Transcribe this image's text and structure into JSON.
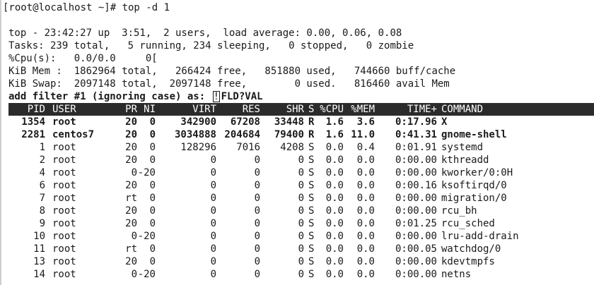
{
  "prompt": "[root@localhost ~]# top -d 1",
  "summary": {
    "top_line": "top - 23:42:27 up  3:51,  2 users,  load average: 0.00, 0.06, 0.08",
    "tasks_line": "Tasks: 239 total,   5 running, 234 sleeping,   0 stopped,   0 zombie",
    "cpu_line": "%Cpu(s):   0.0/0.0     0[",
    "mem_line": "KiB Mem :  1862964 total,   266424 free,   851880 used,   744660 buff/cache",
    "swap_line": "KiB Swap:  2097148 total,  2097148 free,        0 used.   816460 avail Mem"
  },
  "filter_prompt": {
    "label": "add filter #1 (ignoring case) as: ",
    "cursor": "!",
    "input": "FLD?VAL"
  },
  "columns": [
    "PID",
    "USER",
    "PR",
    "NI",
    "VIRT",
    "RES",
    "SHR",
    "S",
    "%CPU",
    "%MEM",
    "TIME+",
    "COMMAND"
  ],
  "processes": [
    {
      "pid": "1354",
      "user": "root",
      "pr": "20",
      "ni": "0",
      "virt": "342900",
      "res": "67208",
      "shr": "33448",
      "s": "R",
      "cpu": "1.6",
      "mem": "3.6",
      "time": "0:17.96",
      "cmd": "X",
      "bold": true
    },
    {
      "pid": "2281",
      "user": "centos7",
      "pr": "20",
      "ni": "0",
      "virt": "3034888",
      "res": "204684",
      "shr": "79400",
      "s": "R",
      "cpu": "1.6",
      "mem": "11.0",
      "time": "0:41.31",
      "cmd": "gnome-shell",
      "bold": true
    },
    {
      "pid": "1",
      "user": "root",
      "pr": "20",
      "ni": "0",
      "virt": "128296",
      "res": "7016",
      "shr": "4208",
      "s": "S",
      "cpu": "0.0",
      "mem": "0.4",
      "time": "0:01.91",
      "cmd": "systemd",
      "bold": false
    },
    {
      "pid": "2",
      "user": "root",
      "pr": "20",
      "ni": "0",
      "virt": "0",
      "res": "0",
      "shr": "0",
      "s": "S",
      "cpu": "0.0",
      "mem": "0.0",
      "time": "0:00.00",
      "cmd": "kthreadd",
      "bold": false
    },
    {
      "pid": "4",
      "user": "root",
      "pr": "0",
      "ni": "-20",
      "virt": "0",
      "res": "0",
      "shr": "0",
      "s": "S",
      "cpu": "0.0",
      "mem": "0.0",
      "time": "0:00.00",
      "cmd": "kworker/0:0H",
      "bold": false
    },
    {
      "pid": "6",
      "user": "root",
      "pr": "20",
      "ni": "0",
      "virt": "0",
      "res": "0",
      "shr": "0",
      "s": "S",
      "cpu": "0.0",
      "mem": "0.0",
      "time": "0:00.16",
      "cmd": "ksoftirqd/0",
      "bold": false
    },
    {
      "pid": "7",
      "user": "root",
      "pr": "rt",
      "ni": "0",
      "virt": "0",
      "res": "0",
      "shr": "0",
      "s": "S",
      "cpu": "0.0",
      "mem": "0.0",
      "time": "0:00.00",
      "cmd": "migration/0",
      "bold": false
    },
    {
      "pid": "8",
      "user": "root",
      "pr": "20",
      "ni": "0",
      "virt": "0",
      "res": "0",
      "shr": "0",
      "s": "S",
      "cpu": "0.0",
      "mem": "0.0",
      "time": "0:00.00",
      "cmd": "rcu_bh",
      "bold": false
    },
    {
      "pid": "9",
      "user": "root",
      "pr": "20",
      "ni": "0",
      "virt": "0",
      "res": "0",
      "shr": "0",
      "s": "S",
      "cpu": "0.0",
      "mem": "0.0",
      "time": "0:01.25",
      "cmd": "rcu_sched",
      "bold": false
    },
    {
      "pid": "10",
      "user": "root",
      "pr": "0",
      "ni": "-20",
      "virt": "0",
      "res": "0",
      "shr": "0",
      "s": "S",
      "cpu": "0.0",
      "mem": "0.0",
      "time": "0:00.00",
      "cmd": "lru-add-drain",
      "bold": false
    },
    {
      "pid": "11",
      "user": "root",
      "pr": "rt",
      "ni": "0",
      "virt": "0",
      "res": "0",
      "shr": "0",
      "s": "S",
      "cpu": "0.0",
      "mem": "0.0",
      "time": "0:00.05",
      "cmd": "watchdog/0",
      "bold": false
    },
    {
      "pid": "13",
      "user": "root",
      "pr": "20",
      "ni": "0",
      "virt": "0",
      "res": "0",
      "shr": "0",
      "s": "S",
      "cpu": "0.0",
      "mem": "0.0",
      "time": "0:00.00",
      "cmd": "kdevtmpfs",
      "bold": false
    },
    {
      "pid": "14",
      "user": "root",
      "pr": "0",
      "ni": "-20",
      "virt": "0",
      "res": "0",
      "shr": "0",
      "s": "S",
      "cpu": "0.0",
      "mem": "0.0",
      "time": "0:00.00",
      "cmd": "netns",
      "bold": false
    }
  ],
  "colors": {
    "header_bg": "#2b2b2b",
    "header_fg": "#ffffff",
    "text": "#1a1a1a",
    "background": "#ffffff"
  }
}
